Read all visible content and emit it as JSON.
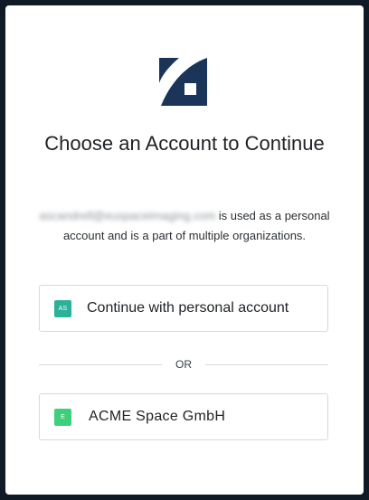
{
  "title": "Choose an Account to Continue",
  "description": {
    "email": "ascandrell@euspaceimaging.com",
    "text": "is used as a personal account and is a part of multiple organizations."
  },
  "personal_option": {
    "badge": "AS",
    "label": "Continue with personal account",
    "badge_color": "#2bb198"
  },
  "divider": {
    "label": "OR"
  },
  "organizations": [
    {
      "badge": "E",
      "label": "ACME Space GmbH",
      "badge_color": "#3ecf7a"
    }
  ],
  "brand": {
    "logo_color": "#1a3558",
    "logo_icon": "brand-logo-icon"
  }
}
